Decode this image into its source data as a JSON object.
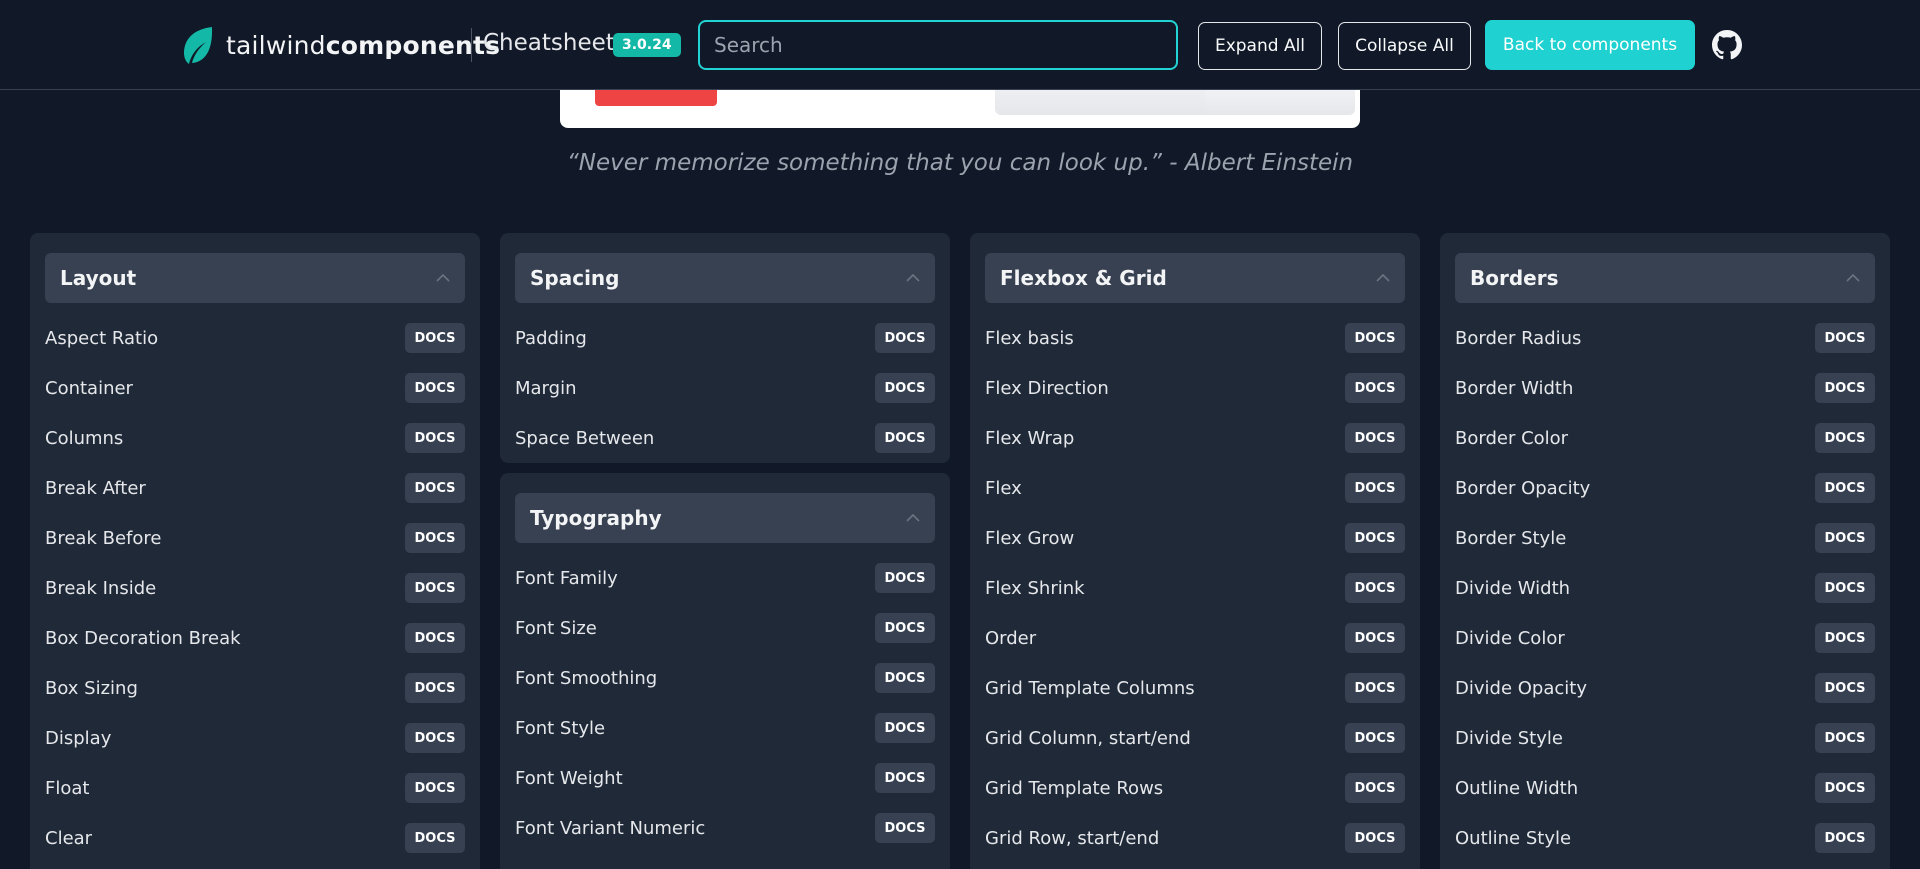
{
  "header": {
    "logo_light": "tailwind",
    "logo_bold": "components",
    "cheatsheet": "Cheatsheet",
    "version": "3.0.24",
    "search_placeholder": "Search",
    "expand_all": "Expand All",
    "collapse_all": "Collapse All",
    "back": "Back to components",
    "accent_color": "#14b8a6"
  },
  "quote": "“Never memorize something that you can look up.” - Albert Einstein",
  "docs_label": "DOCS",
  "cards": {
    "layout": {
      "title": "Layout",
      "items": [
        "Aspect Ratio",
        "Container",
        "Columns",
        "Break After",
        "Break Before",
        "Break Inside",
        "Box Decoration Break",
        "Box Sizing",
        "Display",
        "Float",
        "Clear"
      ]
    },
    "spacing": {
      "title": "Spacing",
      "items": [
        "Padding",
        "Margin",
        "Space Between"
      ]
    },
    "typography": {
      "title": "Typography",
      "items": [
        "Font Family",
        "Font Size",
        "Font Smoothing",
        "Font Style",
        "Font Weight",
        "Font Variant Numeric"
      ]
    },
    "flexbox": {
      "title": "Flexbox & Grid",
      "items": [
        "Flex basis",
        "Flex Direction",
        "Flex Wrap",
        "Flex",
        "Flex Grow",
        "Flex Shrink",
        "Order",
        "Grid Template Columns",
        "Grid Column, start/end",
        "Grid Template Rows",
        "Grid Row, start/end"
      ]
    },
    "borders": {
      "title": "Borders",
      "items": [
        "Border Radius",
        "Border Width",
        "Border Color",
        "Border Opacity",
        "Border Style",
        "Divide Width",
        "Divide Color",
        "Divide Opacity",
        "Divide Style",
        "Outline Width",
        "Outline Style"
      ]
    }
  }
}
